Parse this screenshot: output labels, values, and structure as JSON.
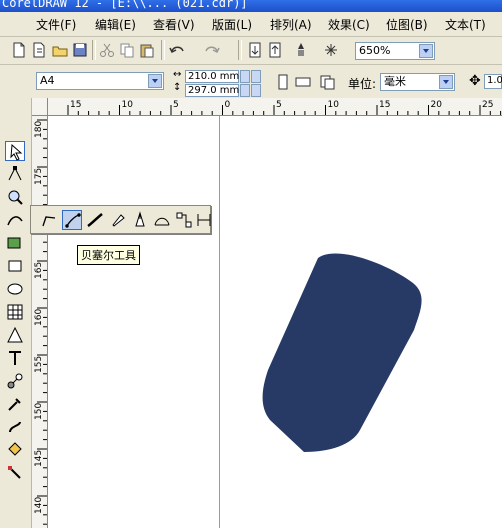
{
  "window": {
    "title": "CorelDRAW 12 - [E:\\\\... (021.cdr)]"
  },
  "menubar": {
    "items": [
      "文件(F)",
      "编辑(E)",
      "查看(V)",
      "版面(L)",
      "排列(A)",
      "效果(C)",
      "位图(B)",
      "文本(T)"
    ]
  },
  "toolbar": {
    "zoom_value": "650%"
  },
  "property_bar": {
    "paper_size": "A4",
    "width": "210.0 mm",
    "height": "297.0 mm",
    "unit_label": "单位:",
    "unit_value": "毫米",
    "nudge_value": "1.0"
  },
  "ruler": {
    "top_labels": [
      "15",
      "10",
      "5",
      "0",
      "5",
      "10",
      "15",
      "20",
      "25"
    ],
    "left_labels": [
      "180",
      "175",
      "170",
      "165",
      "160",
      "155",
      "150",
      "145",
      "140"
    ]
  },
  "flyout": {
    "tooltip": "贝塞尔工具"
  },
  "shape": {
    "fill": "#273a66"
  }
}
